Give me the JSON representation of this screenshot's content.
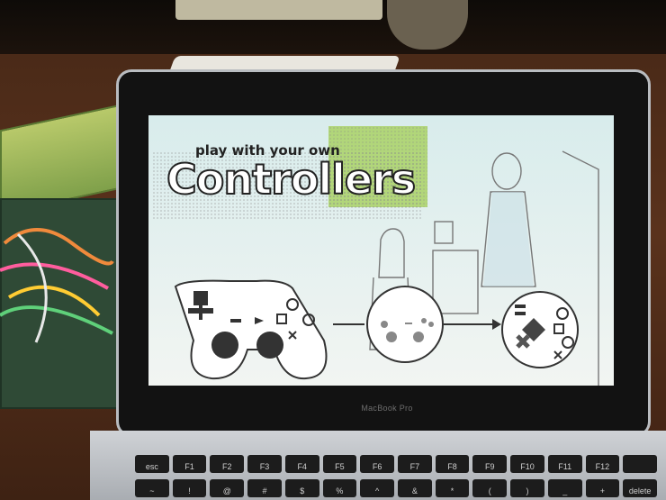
{
  "screen": {
    "headline_small": "play with your own",
    "headline_big": "Controllers"
  },
  "laptop": {
    "brand": "MacBook Pro"
  },
  "keyboard": {
    "keys": [
      "esc",
      "F1",
      "F2",
      "F3",
      "F4",
      "F5",
      "F6",
      "F7",
      "F8",
      "F9",
      "F10",
      "F11",
      "F12",
      "delete"
    ],
    "keys_row2": [
      "~",
      "!",
      "@",
      "#",
      "$",
      "%",
      "^",
      "&",
      "*",
      "(",
      ")",
      "_",
      "+",
      "delete"
    ]
  },
  "colors": {
    "screen_bg": "#dfeeee",
    "accent_green": "#a6cf5d",
    "table_wood": "#5a321c"
  }
}
